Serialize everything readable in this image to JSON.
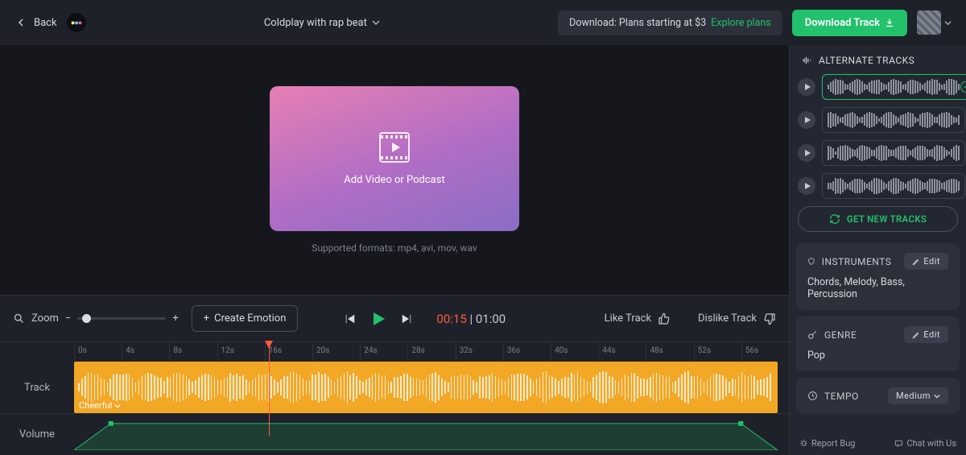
{
  "header": {
    "back": "Back",
    "title": "Coldplay with rap beat",
    "promo_text": "Download: Plans starting at $3",
    "promo_link": "Explore plans",
    "download": "Download Track"
  },
  "stage": {
    "drop_label": "Add Video or Podcast",
    "formats": "Supported formats: mp4, avi, mov, wav"
  },
  "toolbar": {
    "zoom": "Zoom",
    "create_emotion": "Create Emotion",
    "time_current": "00:15",
    "time_total": "01:00",
    "like": "Like Track",
    "dislike": "Dislike Track"
  },
  "timeline": {
    "ticks": [
      "0s",
      "4s",
      "8s",
      "12s",
      "16s",
      "20s",
      "24s",
      "28s",
      "32s",
      "36s",
      "40s",
      "44s",
      "48s",
      "52s",
      "56s"
    ],
    "track_label": "Track",
    "emotion": "Cheerful",
    "volume_label": "Volume"
  },
  "alt": {
    "heading": "ALTERNATE TRACKS",
    "tracks": [
      {
        "selected": true
      },
      {
        "selected": false
      },
      {
        "selected": false
      },
      {
        "selected": false
      }
    ],
    "get_new": "GET NEW TRACKS"
  },
  "panels": {
    "instruments_h": "INSTRUMENTS",
    "instruments": "Chords, Melody, Bass, Percussion",
    "genre_h": "GENRE",
    "genre": "Pop",
    "tempo_h": "TEMPO",
    "tempo": "Medium",
    "edit": "Edit"
  },
  "footer": {
    "bug": "Report Bug",
    "chat": "Chat with Us"
  },
  "colors": {
    "accent": "#22c16b",
    "track": "#f2a725",
    "playhead": "#ff5a3d"
  }
}
